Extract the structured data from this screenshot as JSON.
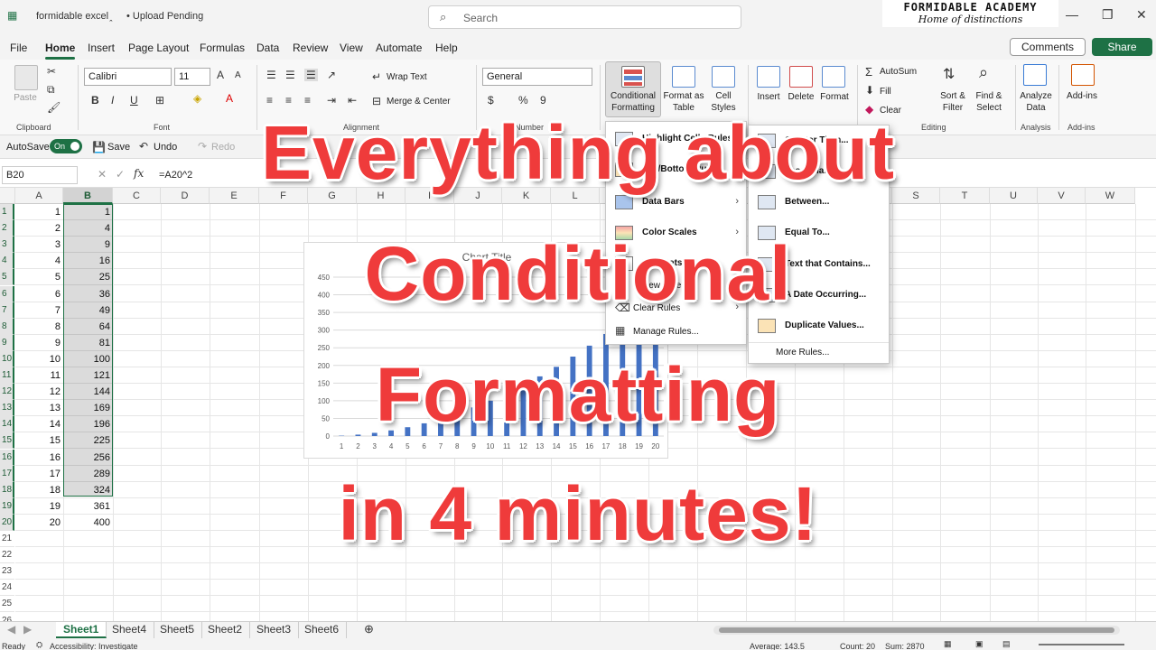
{
  "title_bar": {
    "file_name": "formidable excel",
    "status": "• Upload Pending",
    "search_placeholder": "Search",
    "logo_line1": "FORMIDABLE ACADEMY",
    "logo_line2": "Home of distinctions"
  },
  "menu_tabs": [
    "File",
    "Home",
    "Insert",
    "Page Layout",
    "Formulas",
    "Data",
    "Review",
    "View",
    "Automate",
    "Help"
  ],
  "actions": {
    "comments": "Comments",
    "share": "Share"
  },
  "ribbon": {
    "paste": "Paste",
    "clipboard": "Clipboard",
    "font_name": "Calibri",
    "font_size": "11",
    "font_group": "Font",
    "wrap_text": "Wrap Text",
    "merge_center": "Merge & Center",
    "alignment_group": "Alignment",
    "number_format": "General",
    "number_group": "Number",
    "conditional_formatting": "Conditional\nFormatting",
    "format_as_table": "Format as\nTable",
    "cell_styles": "Cell\nStyles",
    "insert": "Insert",
    "delete": "Delete",
    "format": "Format",
    "autosum": "AutoSum",
    "fill": "Fill",
    "clear": "Clear",
    "editing_group": "Editing",
    "sort_filter": "Sort &\nFilter",
    "find_select": "Find &\nSelect",
    "analyze_data": "Analyze\nData",
    "analysis_group": "Analysis",
    "addins": "Add-ins",
    "addins_group": "Add-ins"
  },
  "qat": {
    "autosave": "AutoSave",
    "toggle": "On",
    "save": "Save",
    "undo": "Undo",
    "redo": "Redo"
  },
  "formula_bar": {
    "name_box": "B20",
    "formula": "=A20^2"
  },
  "columns": [
    "A",
    "B",
    "C",
    "D",
    "E",
    "F",
    "G",
    "H",
    "I",
    "J",
    "K",
    "L",
    "M",
    "N",
    "O",
    "P",
    "Q",
    "R",
    "S",
    "T",
    "U",
    "V",
    "W"
  ],
  "rows": [
    1,
    2,
    3,
    4,
    5,
    6,
    7,
    8,
    9,
    10,
    11,
    12,
    13,
    14,
    15,
    16,
    17,
    18,
    19,
    20,
    21,
    22,
    23,
    24,
    25,
    26
  ],
  "col_a": [
    1,
    2,
    3,
    4,
    5,
    6,
    7,
    8,
    9,
    10,
    11,
    12,
    13,
    14,
    15,
    16,
    17,
    18,
    19,
    20
  ],
  "col_b": [
    1,
    4,
    9,
    16,
    25,
    36,
    49,
    64,
    81,
    100,
    121,
    144,
    169,
    196,
    225,
    256,
    289,
    324,
    361,
    400
  ],
  "cf_menu": {
    "items": [
      "Highlight Cells Rules",
      "Top/Bottom Rules",
      "Data Bars",
      "Color Scales",
      "Icon Sets",
      "New Rule...",
      "Clear Rules",
      "Manage Rules..."
    ]
  },
  "sub_menu": {
    "items": [
      "Greater Than...",
      "Less Than...",
      "Between...",
      "Equal To...",
      "Text that Contains...",
      "A Date Occurring...",
      "Duplicate Values..."
    ],
    "more": "More Rules..."
  },
  "sheets": [
    "Sheet1",
    "Sheet4",
    "Sheet5",
    "Sheet2",
    "Sheet3",
    "Sheet6"
  ],
  "status_bar": {
    "ready": "Ready",
    "accessibility": "Accessibility: Investigate",
    "average": "Average: 143.5",
    "count": "Count: 20",
    "sum": "Sum: 2870"
  },
  "headline": [
    "Everything about",
    "Conditional",
    "Formatting",
    "in 4 minutes!"
  ],
  "chart_data": {
    "type": "bar",
    "title": "Chart Title",
    "categories": [
      1,
      2,
      3,
      4,
      5,
      6,
      7,
      8,
      9,
      10,
      11,
      12,
      13,
      14,
      15,
      16,
      17,
      18,
      19,
      20
    ],
    "values": [
      1,
      4,
      9,
      16,
      25,
      36,
      49,
      64,
      81,
      100,
      121,
      144,
      169,
      196,
      225,
      256,
      289,
      324,
      361,
      400
    ],
    "y_ticks": [
      0,
      50,
      100,
      150,
      200,
      250,
      300,
      350,
      400,
      450
    ],
    "ylim": [
      0,
      450
    ],
    "bar_color": "#4472c4",
    "grid": true
  },
  "colors": {
    "accent": "#1e7145",
    "headline": "#ef3b3b"
  }
}
